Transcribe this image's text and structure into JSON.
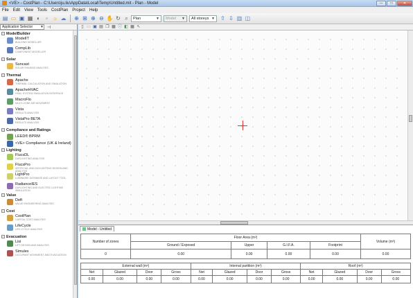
{
  "window": {
    "title": "<VE> - CostPlan - C:\\Users\\ju.liu\\AppData\\Local\\Temp\\Untitled.mit - Plan - Model",
    "minimize": "—",
    "maximize": "□",
    "close": "✕"
  },
  "menu": [
    "File",
    "Edit",
    "View",
    "Tools",
    "CostPlan",
    "Project",
    "Help"
  ],
  "toolbar": {
    "view_select": "Plan",
    "model_select": "Model",
    "storeys_select": "All storeys"
  },
  "left_panel": {
    "selector_label": "Application Selector",
    "groups": [
      {
        "name": "ModelBuilder",
        "items": [
          {
            "name": "ModelIT",
            "desc": "Building modeller",
            "color": "#6c8fc9"
          },
          {
            "name": "CompLib",
            "desc": "Component modeller",
            "color": "#5a79b5"
          }
        ]
      },
      {
        "name": "Solar",
        "items": [
          {
            "name": "Suncast",
            "desc": "Solar shading analysis",
            "color": "#e8b84a"
          }
        ]
      },
      {
        "name": "Thermal",
        "items": [
          {
            "name": "Apache",
            "desc": "Thermal calculation and simulation",
            "color": "#d16b4a"
          },
          {
            "name": "ApacheHVAC",
            "desc": "HVAC system simulation interface",
            "color": "#5c8a9e"
          },
          {
            "name": "MacroFlo",
            "desc": "Multi-zone air movement",
            "color": "#5e9c6a"
          },
          {
            "name": "Vista",
            "desc": "Results analysis",
            "color": "#7c7cc0"
          },
          {
            "name": "VistaPro BETA",
            "desc": "Results analysis",
            "color": "#4f6aa8"
          }
        ]
      },
      {
        "name": "Compliance and Ratings",
        "items": [
          {
            "name": "LEED® BPRM",
            "desc": "",
            "color": "#74a34e"
          },
          {
            "name": "<VE> Compliance (UK & Ireland)",
            "desc": "",
            "color": "#3a67a8"
          }
        ]
      },
      {
        "name": "Lighting",
        "items": [
          {
            "name": "FlucsDL",
            "desc": "Daylighting analysis",
            "color": "#a5c856"
          },
          {
            "name": "FlucsPro",
            "desc": "Artificial and daylighting design and analysis",
            "color": "#e3d04a"
          },
          {
            "name": "LightPro",
            "desc": "Luminaire database and layout tool",
            "color": "#cfcf6c"
          },
          {
            "name": "RadianceIES",
            "desc": "Daylighting and electric lighting simulation",
            "color": "#8c6bb0"
          }
        ]
      },
      {
        "name": "Value",
        "items": [
          {
            "name": "Deft",
            "desc": "Value engineering analysis",
            "color": "#c98a3a"
          }
        ]
      },
      {
        "name": "Cost",
        "items": [
          {
            "name": "CostPlan",
            "desc": "Capital cost analysis",
            "color": "#d4a244"
          },
          {
            "name": "LifeCycle",
            "desc": "Life-cycle analysis",
            "color": "#6a9bc7"
          }
        ]
      },
      {
        "name": "Evacuation",
        "items": [
          {
            "name": "Lisi",
            "desc": "Lift design and analysis",
            "color": "#4f8a4f"
          },
          {
            "name": "Simulex",
            "desc": "Occupant movement and evacuation",
            "color": "#b05050"
          }
        ]
      }
    ]
  },
  "bottom_panel": {
    "tab_label": "Model - Untitled",
    "table1": {
      "col_zones": "Number of zones",
      "col_floor_area": "Floor Area (m²)",
      "sub_cols": [
        "Ground / Exposed",
        "Upper",
        "G.I.F.A.",
        "Footprint"
      ],
      "col_volume": "Volume (m³)",
      "values": {
        "zones": "0",
        "ground": "0.00",
        "upper": "0.00",
        "gifa": "0.00",
        "footprint": "0.00",
        "volume": "0.00"
      }
    },
    "table2": {
      "groups": [
        "External wall (m²)",
        "Internal partition (m²)",
        "Roof (m²)"
      ],
      "sub_cols": [
        "Net",
        "Glazed",
        "Door",
        "Gross"
      ],
      "values": [
        "0.00",
        "0.00",
        "0.00",
        "0.00",
        "0.00",
        "0.00",
        "0.00",
        "0.00",
        "0.00",
        "0.00",
        "0.00",
        "0.00"
      ]
    }
  }
}
